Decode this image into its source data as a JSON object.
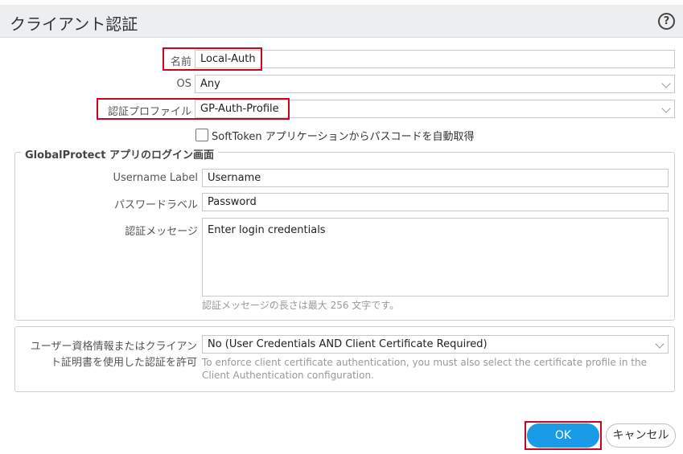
{
  "dialog": {
    "title": "クライアント認証",
    "help_icon": "?"
  },
  "fields": {
    "name": {
      "label": "名前",
      "value": "Local-Auth"
    },
    "os": {
      "label": "OS",
      "value": "Any"
    },
    "auth_profile": {
      "label": "認証プロファイル",
      "value": "GP-Auth-Profile"
    },
    "softtoken": {
      "label": "SoftToken アプリケーションからパスコードを自動取得",
      "checked": false
    }
  },
  "login_group": {
    "legend": "GlobalProtect アプリのログイン画面",
    "username_label": {
      "label": "Username Label",
      "value": "Username"
    },
    "password_label": {
      "label": "パスワードラベル",
      "value": "Password"
    },
    "auth_message": {
      "label": "認証メッセージ",
      "value": "Enter login credentials",
      "hint": "認証メッセージの長さは最大 256 文字です。"
    }
  },
  "cert_group": {
    "label_line1": "ユーザー資格情報またはクライアン",
    "label_line2": "ト証明書を使用した認証を許可",
    "value": "No (User Credentials AND Client Certificate Required)",
    "hint_line1": "To enforce client certificate authentication, you must also select the certificate profile in the",
    "hint_line2": "Client Authentication configuration."
  },
  "buttons": {
    "ok": "OK",
    "cancel": "キャンセル"
  },
  "colors": {
    "highlight": "#d0021b",
    "primary": "#1a9be8"
  }
}
